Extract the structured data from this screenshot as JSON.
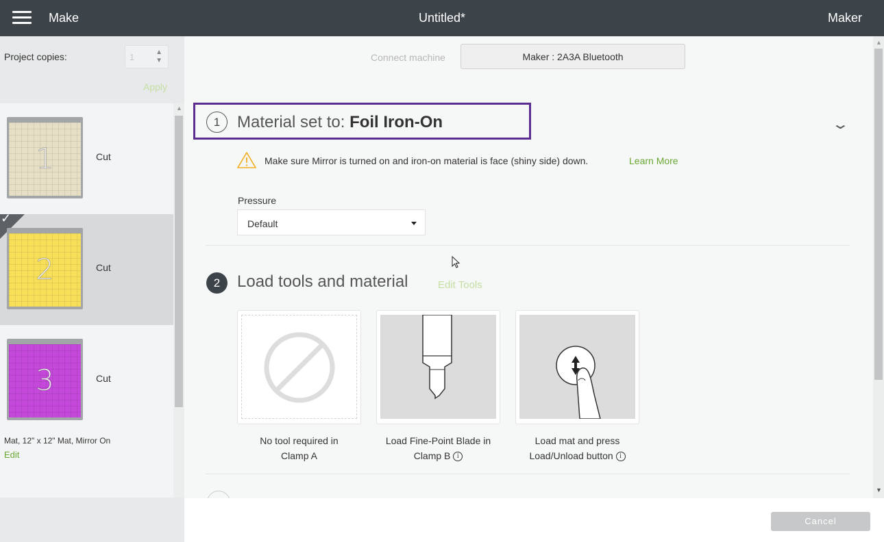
{
  "topbar": {
    "menu_icon": "hamburger-menu-icon",
    "section": "Make",
    "title": "Untitled*",
    "machine": "Maker"
  },
  "sidebar": {
    "copies_label": "Project copies:",
    "copies_value": "1",
    "apply_label": "Apply",
    "mats": [
      {
        "number": "1",
        "label": "Cut",
        "color": "#e6dfc5",
        "selected": false
      },
      {
        "number": "2",
        "label": "Cut",
        "color": "#f8df5a",
        "selected": true
      },
      {
        "number": "3",
        "label": "Cut",
        "color": "#c449db",
        "selected": false
      }
    ],
    "mat_info": "Mat, 12\" x 12\" Mat, Mirror On",
    "edit_label": "Edit"
  },
  "main": {
    "connect_label": "Connect machine",
    "connect_button": "Maker : 2A3A Bluetooth",
    "step1": {
      "number": "1",
      "title_prefix": "Material set to: ",
      "material": "Foil Iron-On",
      "warning": "Make sure Mirror is turned on and iron-on material is face (shiny side) down.",
      "learn_more": "Learn More",
      "pressure_label": "Pressure",
      "pressure_value": "Default"
    },
    "step2": {
      "number": "2",
      "title": "Load tools and material",
      "edit_tools": "Edit Tools",
      "cards": [
        {
          "line1": "No tool required in",
          "line2": "Clamp A",
          "info": false,
          "icon": "no-tool-icon"
        },
        {
          "line1": "Load Fine-Point Blade in",
          "line2": "Clamp B",
          "info": true,
          "icon": "fine-point-blade-icon"
        },
        {
          "line1": "Load mat and press",
          "line2": "Load/Unload button",
          "info": true,
          "icon": "load-unload-button-icon"
        }
      ]
    }
  },
  "footer": {
    "cancel_label": "Cancel"
  },
  "colors": {
    "topbar": "#3d4449",
    "accent_green": "#6aa834",
    "highlight_purple": "#5c2d91",
    "warning_yellow": "#f0ad1e"
  }
}
